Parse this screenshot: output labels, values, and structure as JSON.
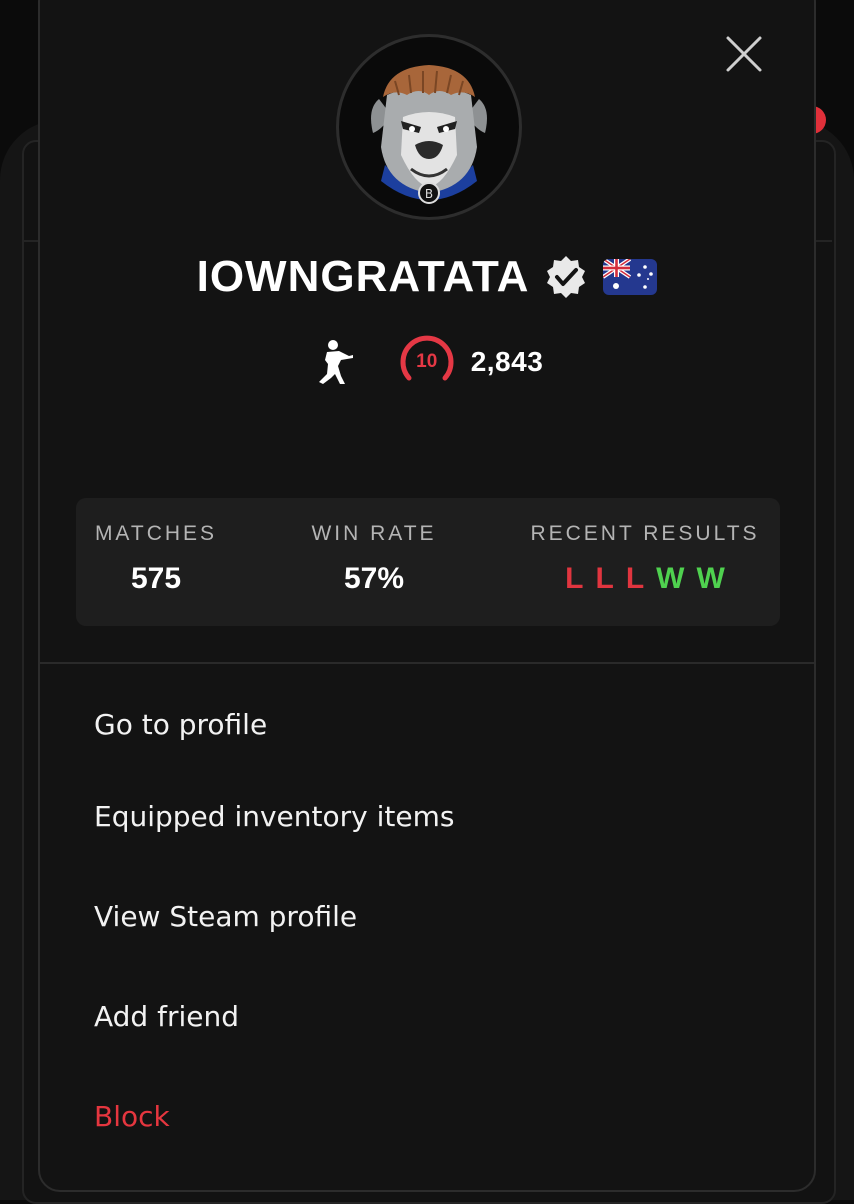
{
  "profile": {
    "username": "IOWNGRATATA",
    "level": "10",
    "elo": "2,843"
  },
  "stats": {
    "matches_label": "MATCHES",
    "matches_value": "575",
    "winrate_label": "WIN RATE",
    "winrate_value": "57%",
    "recent_label": "RECENT RESULTS",
    "recent": [
      "L",
      "L",
      "L",
      "W",
      "W"
    ]
  },
  "menu": {
    "go_to_profile": "Go to profile",
    "equipped_items": "Equipped inventory items",
    "view_steam": "View Steam profile",
    "add_friend": "Add friend",
    "block": "Block"
  },
  "colors": {
    "loss": "#e0353f",
    "win": "#4fd14f",
    "danger": "#e5363f",
    "level": "#e53845"
  },
  "icons": {
    "close": "close-icon",
    "verified": "verified-badge-icon",
    "flag": "australia-flag-icon",
    "game": "counter-strike-soldier-icon",
    "level": "level-gauge-icon"
  }
}
